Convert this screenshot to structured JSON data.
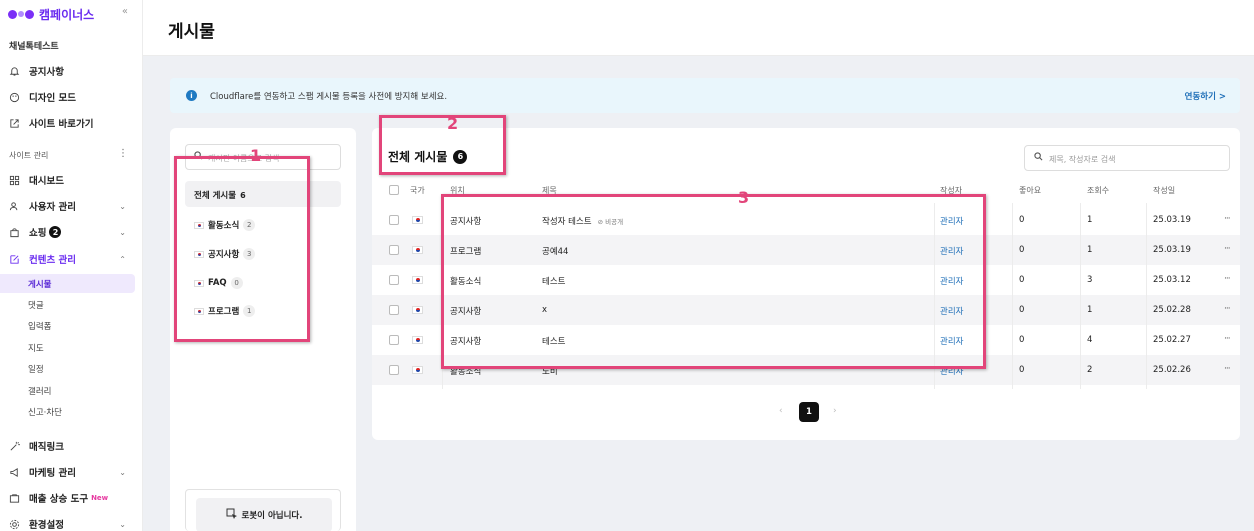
{
  "sidebar": {
    "logo_text": "캠페이너스",
    "collapse_icon": "«",
    "channel_name": "채널톡테스트",
    "top_items": [
      {
        "label": "공지사항",
        "icon": "bell-icon"
      },
      {
        "label": "디자인 모드",
        "icon": "palette-icon"
      },
      {
        "label": "사이트 바로가기",
        "icon": "external-link-icon"
      }
    ],
    "section_label": "사이트 관리",
    "section_more": "⋮",
    "items": [
      {
        "label": "대시보드",
        "icon": "grid-icon"
      },
      {
        "label": "사용자 관리",
        "icon": "users-icon"
      },
      {
        "label": "쇼핑",
        "icon": "bag-icon",
        "badge": "2"
      },
      {
        "label": "컨텐츠 관리",
        "icon": "edit-icon"
      }
    ],
    "sub_items": [
      "게시물",
      "댓글",
      "입력폼",
      "지도",
      "일정",
      "갤러리",
      "신고·차단"
    ],
    "bottom_items": [
      {
        "label": "매직링크",
        "icon": "magic-icon"
      },
      {
        "label": "마케팅 관리",
        "icon": "megaphone-icon"
      },
      {
        "label": "매출 상승 도구",
        "icon": "tool-icon",
        "tag": "New"
      },
      {
        "label": "환경설정",
        "icon": "gear-icon"
      }
    ]
  },
  "header": {
    "title": "게시물"
  },
  "banner": {
    "text": "Cloudflare를 연동하고 스팸 게시물 등록을 사전에 방지해 보세요.",
    "link": "연동하기 >"
  },
  "boards": {
    "search_placeholder": "게시판 이름으로 검색",
    "all_label": "전체 게시물",
    "all_count": "6",
    "items": [
      {
        "label": "활동소식",
        "count": "2"
      },
      {
        "label": "공지사항",
        "count": "3"
      },
      {
        "label": "FAQ",
        "count": "0"
      },
      {
        "label": "프로그램",
        "count": "1"
      }
    ],
    "captcha": "로봇이 아닙니다."
  },
  "posts": {
    "title": "전체 게시물",
    "count": "6",
    "search_placeholder": "제목, 작성자로 검색",
    "columns": {
      "country": "국가",
      "location": "위치",
      "title": "제목",
      "author": "작성자",
      "likes": "좋아요",
      "views": "조회수",
      "date": "작성일"
    },
    "rows": [
      {
        "location": "공지사항",
        "title": "작성자 테스트",
        "private": "비공개",
        "author": "관리자",
        "likes": "0",
        "views": "1",
        "date": "25.03.19"
      },
      {
        "location": "프로그램",
        "title": "공예44",
        "private": "",
        "author": "관리자",
        "likes": "0",
        "views": "1",
        "date": "25.03.19"
      },
      {
        "location": "활동소식",
        "title": "테스트",
        "private": "",
        "author": "관리자",
        "likes": "0",
        "views": "3",
        "date": "25.03.12"
      },
      {
        "location": "공지사항",
        "title": "x",
        "private": "",
        "author": "관리자",
        "likes": "0",
        "views": "1",
        "date": "25.02.28"
      },
      {
        "location": "공지사항",
        "title": "테스트",
        "private": "",
        "author": "관리자",
        "likes": "0",
        "views": "4",
        "date": "25.02.27"
      },
      {
        "location": "활동소식",
        "title": "도비",
        "private": "",
        "author": "관리자",
        "likes": "0",
        "views": "2",
        "date": "25.02.26"
      }
    ],
    "more": "···",
    "pagination": {
      "prev": "‹",
      "current": "1",
      "next": "›"
    }
  },
  "annotations": [
    "1",
    "2",
    "3"
  ],
  "colors": {
    "accent": "#6a2cf0",
    "annotation": "#e2457a",
    "link": "#1f6fb8"
  }
}
